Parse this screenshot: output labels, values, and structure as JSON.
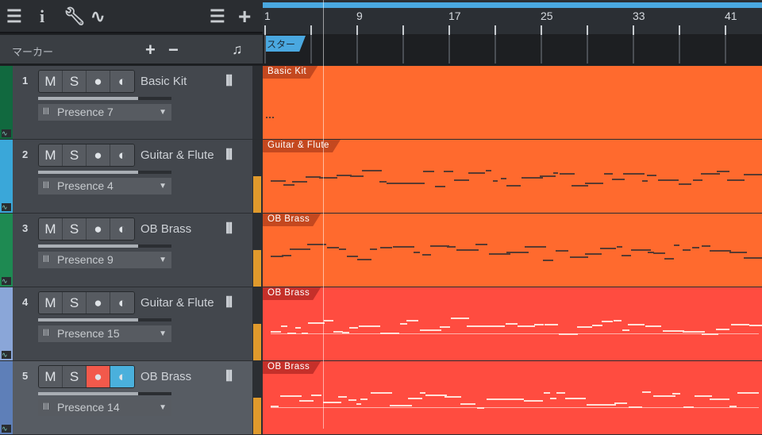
{
  "toolbar": {
    "icons": [
      "menu-icon",
      "info-icon",
      "wrench-icon",
      "automation-icon",
      "list-icon",
      "add-track-icon"
    ]
  },
  "marker_bar": {
    "label": "マーカー",
    "add": "+",
    "remove": "−",
    "note_icon": "♫"
  },
  "ruler": {
    "bars": [
      "1",
      "9",
      "17",
      "25",
      "33",
      "41"
    ],
    "start_marker": "スタート"
  },
  "buttons": {
    "mute": "M",
    "solo": "S",
    "record": "●",
    "monitor": "◐",
    "keyboard": "ꟾꟾꟾ",
    "preset_icon": "ꟾꟾꟾ",
    "dropdown": "▼",
    "auto": "∿"
  },
  "colors": {
    "clip_orange": "#ff6a2e",
    "clip_red": "#ff4c40",
    "accent_blue": "#4aa8e0"
  },
  "tracks": [
    {
      "number": "1",
      "name": "Basic Kit",
      "preset": "Presence 7",
      "volume": 0.75,
      "color": "#11693f",
      "clip": "Basic Kit",
      "clip_color": "#ff6a2e",
      "selected": false,
      "rec": false,
      "mon": false
    },
    {
      "number": "2",
      "name": "Guitar & Flute",
      "preset": "Presence 4",
      "volume": 0.75,
      "color": "#3aa7d9",
      "clip": "Guitar & Flute",
      "clip_color": "#ff6a2e",
      "selected": false,
      "rec": false,
      "mon": false
    },
    {
      "number": "3",
      "name": "OB Brass",
      "preset": "Presence 9",
      "volume": 0.75,
      "color": "#1e8a52",
      "clip": "OB Brass",
      "clip_color": "#ff6a2e",
      "selected": false,
      "rec": false,
      "mon": false
    },
    {
      "number": "4",
      "name": "Guitar & Flute",
      "preset": "Presence 15",
      "volume": 0.75,
      "color": "#8aa6d8",
      "clip": "OB Brass",
      "clip_color": "#ff4c40",
      "selected": false,
      "rec": false,
      "mon": false
    },
    {
      "number": "5",
      "name": "OB Brass",
      "preset": "Presence 14",
      "volume": 0.75,
      "color": "#5e7fb8",
      "clip": "OB Brass",
      "clip_color": "#ff4c40",
      "selected": true,
      "rec": true,
      "mon": true
    }
  ]
}
